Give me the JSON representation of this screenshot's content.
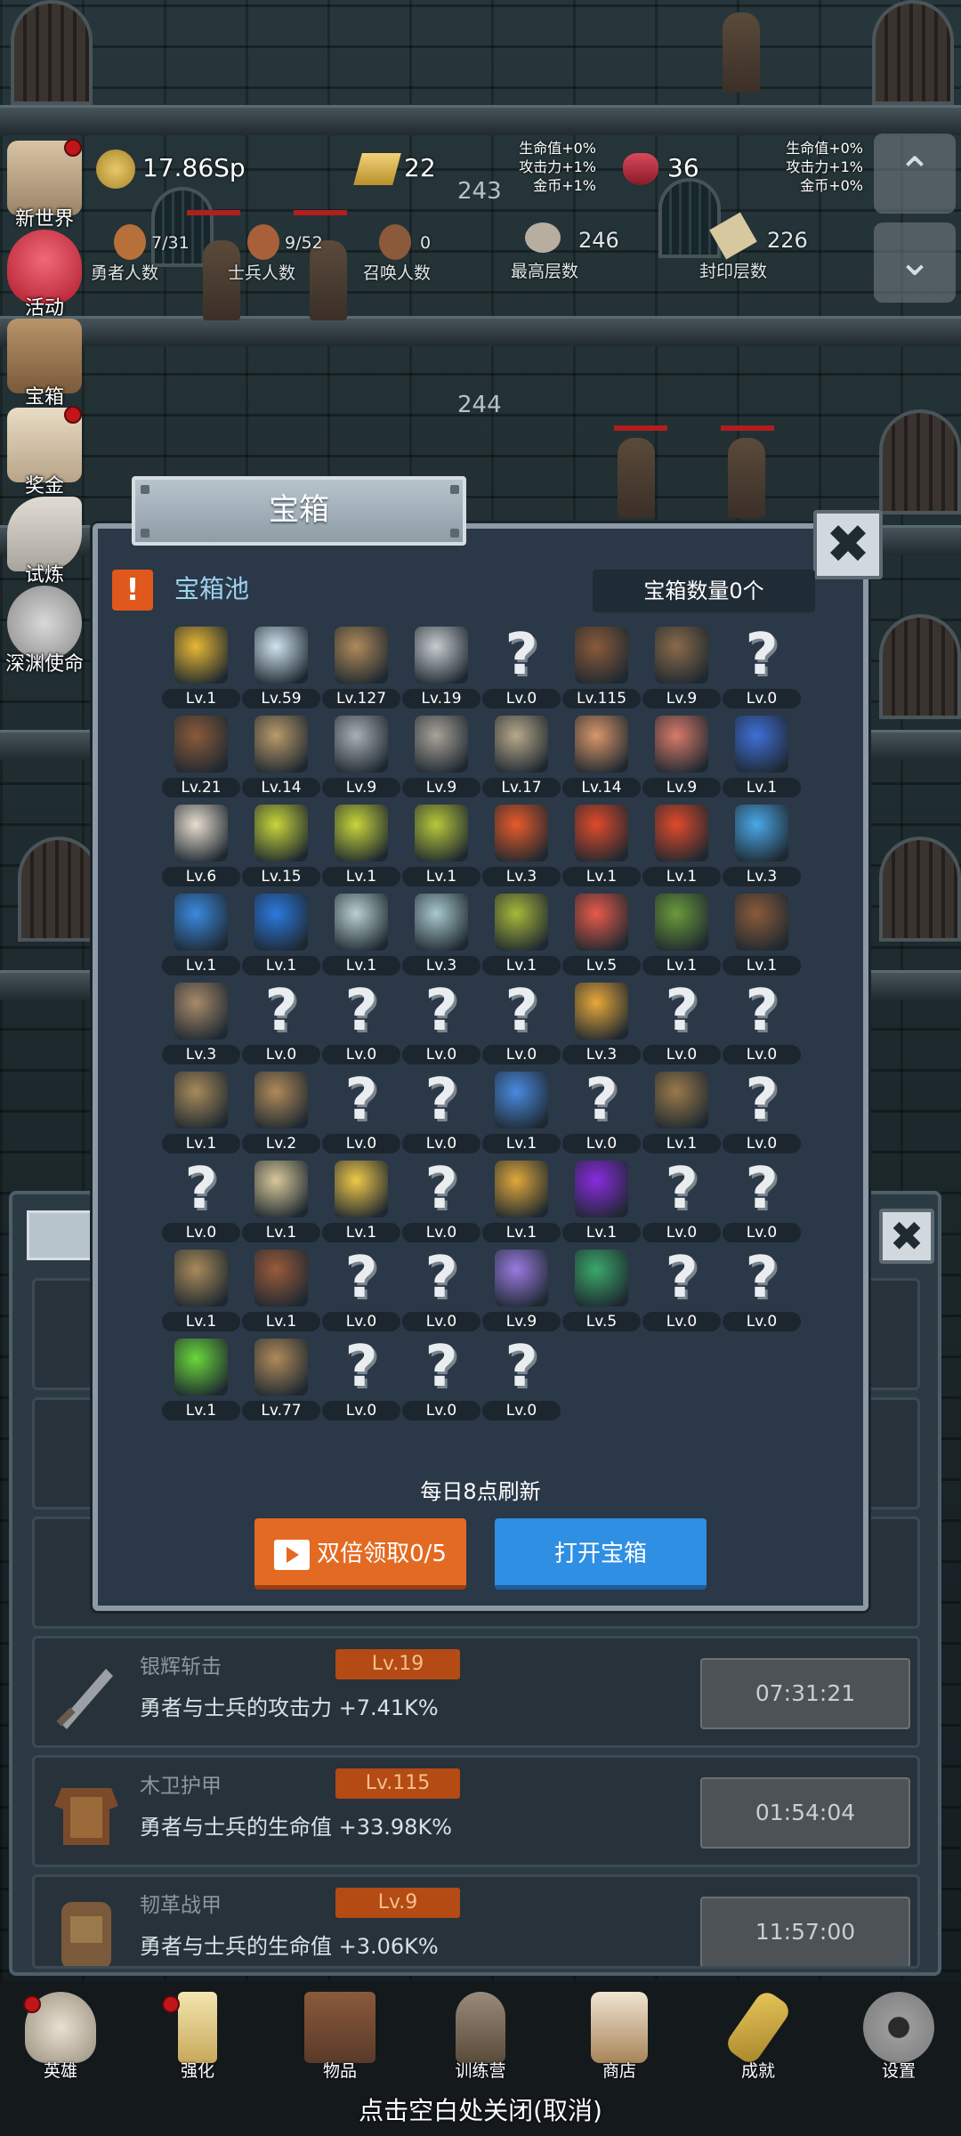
{
  "top_stats": {
    "gold": "17.86Sp",
    "ingot": "22",
    "gem": "36",
    "floor_a": "243",
    "floor_b": "244",
    "bonus_left": [
      "生命值+0%",
      "攻击力+1%",
      "金币+1%"
    ],
    "bonus_right": [
      "生命值+0%",
      "攻击力+1%",
      "金币+0%"
    ],
    "hero_count": "7/31",
    "hero_label": "勇者人数",
    "soldier_count": "9/52",
    "soldier_label": "士兵人数",
    "summon_count": "0",
    "summon_label": "召唤人数",
    "max_floor": "246",
    "max_floor_label": "最高层数",
    "seal_floor": "226",
    "seal_floor_label": "封印层数"
  },
  "side_menu": [
    "新世界",
    "活动",
    "宝箱",
    "奖金",
    "试炼",
    "深渊使命"
  ],
  "modal": {
    "title": "宝箱",
    "pool_label": "宝箱池",
    "chest_count": "宝箱数量0个",
    "refresh_text": "每日8点刷新",
    "double_btn": "双倍领取0/5",
    "open_btn": "打开宝箱",
    "close_icon": "✖"
  },
  "items": [
    {
      "icon": "crown",
      "lv": "Lv.1",
      "c": "#e8b833"
    },
    {
      "icon": "diamond",
      "lv": "Lv.59",
      "c": "#cfe3ee"
    },
    {
      "icon": "sword",
      "lv": "Lv.127",
      "c": "#b08a5a"
    },
    {
      "icon": "sword",
      "lv": "Lv.19",
      "c": "#c7ccd0"
    },
    {
      "icon": "?",
      "lv": "Lv.0"
    },
    {
      "icon": "armor",
      "lv": "Lv.115",
      "c": "#8a5a3a"
    },
    {
      "icon": "backpack",
      "lv": "Lv.9",
      "c": "#8a6a4a"
    },
    {
      "icon": "?",
      "lv": "Lv.0"
    },
    {
      "icon": "helmet",
      "lv": "Lv.21",
      "c": "#8a5a3a"
    },
    {
      "icon": "dagger",
      "lv": "Lv.14",
      "c": "#b99a6a"
    },
    {
      "icon": "helmet",
      "lv": "Lv.9",
      "c": "#a9b0b5"
    },
    {
      "icon": "hammer",
      "lv": "Lv.9",
      "c": "#a9a29a"
    },
    {
      "icon": "helmet",
      "lv": "Lv.17",
      "c": "#b8a88a"
    },
    {
      "icon": "meat",
      "lv": "Lv.14",
      "c": "#d9966a"
    },
    {
      "icon": "steak",
      "lv": "Lv.9",
      "c": "#d97a6a"
    },
    {
      "icon": "bag",
      "lv": "Lv.1",
      "c": "#3f6fd9"
    },
    {
      "icon": "flour",
      "lv": "Lv.6",
      "c": "#e8ddd0"
    },
    {
      "icon": "potion",
      "lv": "Lv.15",
      "c": "#c8d63a"
    },
    {
      "icon": "potion",
      "lv": "Lv.1",
      "c": "#c8d63a"
    },
    {
      "icon": "potion",
      "lv": "Lv.1",
      "c": "#b8c83a"
    },
    {
      "icon": "potion",
      "lv": "Lv.3",
      "c": "#e85a2a"
    },
    {
      "icon": "potion",
      "lv": "Lv.1",
      "c": "#e04a2a"
    },
    {
      "icon": "potion",
      "lv": "Lv.1",
      "c": "#e04a2a"
    },
    {
      "icon": "potion",
      "lv": "Lv.3",
      "c": "#4aa8e8"
    },
    {
      "icon": "potion",
      "lv": "Lv.1",
      "c": "#3a8ae0"
    },
    {
      "icon": "potion",
      "lv": "Lv.1",
      "c": "#2a7ae0"
    },
    {
      "icon": "bottle",
      "lv": "Lv.1",
      "c": "#b8d0d0"
    },
    {
      "icon": "bottle",
      "lv": "Lv.3",
      "c": "#a8c8cc"
    },
    {
      "icon": "bottle",
      "lv": "Lv.1",
      "c": "#a8b83a"
    },
    {
      "icon": "bottle",
      "lv": "Lv.5",
      "c": "#e85a4a"
    },
    {
      "icon": "boots",
      "lv": "Lv.1",
      "c": "#6a9a3a"
    },
    {
      "icon": "boots",
      "lv": "Lv.1",
      "c": "#8a5a3a"
    },
    {
      "icon": "boots",
      "lv": "Lv.3",
      "c": "#a88a6a"
    },
    {
      "icon": "?",
      "lv": "Lv.0"
    },
    {
      "icon": "?",
      "lv": "Lv.0"
    },
    {
      "icon": "?",
      "lv": "Lv.0"
    },
    {
      "icon": "?",
      "lv": "Lv.0"
    },
    {
      "icon": "torch",
      "lv": "Lv.3",
      "c": "#e8a83a"
    },
    {
      "icon": "?",
      "lv": "Lv.0"
    },
    {
      "icon": "?",
      "lv": "Lv.0"
    },
    {
      "icon": "pickaxe",
      "lv": "Lv.1",
      "c": "#a88a5a"
    },
    {
      "icon": "staff",
      "lv": "Lv.2",
      "c": "#b08a5a"
    },
    {
      "icon": "?",
      "lv": "Lv.0"
    },
    {
      "icon": "?",
      "lv": "Lv.0"
    },
    {
      "icon": "wand",
      "lv": "Lv.1",
      "c": "#4a8ae0"
    },
    {
      "icon": "?",
      "lv": "Lv.0"
    },
    {
      "icon": "backpack",
      "lv": "Lv.1",
      "c": "#9a7a4a"
    },
    {
      "icon": "?",
      "lv": "Lv.0"
    },
    {
      "icon": "?",
      "lv": "Lv.0"
    },
    {
      "icon": "club",
      "lv": "Lv.1",
      "c": "#d8c89a"
    },
    {
      "icon": "cheese",
      "lv": "Lv.1",
      "c": "#f0c84a"
    },
    {
      "icon": "?",
      "lv": "Lv.0"
    },
    {
      "icon": "jar",
      "lv": "Lv.1",
      "c": "#e0a83a"
    },
    {
      "icon": "crystal",
      "lv": "Lv.1",
      "c": "#8a2ae0"
    },
    {
      "icon": "?",
      "lv": "Lv.0"
    },
    {
      "icon": "?",
      "lv": "Lv.0"
    },
    {
      "icon": "bow",
      "lv": "Lv.1",
      "c": "#a88a5a"
    },
    {
      "icon": "quiver",
      "lv": "Lv.1",
      "c": "#9a5a3a"
    },
    {
      "icon": "?",
      "lv": "Lv.0"
    },
    {
      "icon": "?",
      "lv": "Lv.0"
    },
    {
      "icon": "monster",
      "lv": "Lv.9",
      "c": "#9a7ae0"
    },
    {
      "icon": "emblem",
      "lv": "Lv.5",
      "c": "#3aa86a"
    },
    {
      "icon": "?",
      "lv": "Lv.0"
    },
    {
      "icon": "?",
      "lv": "Lv.0"
    },
    {
      "icon": "wand",
      "lv": "Lv.1",
      "c": "#6ad83a"
    },
    {
      "icon": "mug",
      "lv": "Lv.77",
      "c": "#b08a5a"
    },
    {
      "icon": "?",
      "lv": "Lv.0"
    },
    {
      "icon": "?",
      "lv": "Lv.0"
    },
    {
      "icon": "?",
      "lv": "Lv.0"
    }
  ],
  "equip_list": [
    {
      "name": "银辉斩击",
      "lv": "Lv.19",
      "desc": "勇者与士兵的攻击力 +7.41K%",
      "timer": "07:31:21",
      "icon": "sword"
    },
    {
      "name": "木卫护甲",
      "lv": "Lv.115",
      "desc": "勇者与士兵的生命值 +33.98K%",
      "timer": "01:54:04",
      "icon": "armor"
    },
    {
      "name": "韧革战甲",
      "lv": "Lv.9",
      "desc": "勇者与士兵的生命值 +3.06K%",
      "timer": "11:57:00",
      "icon": "backpack"
    }
  ],
  "bottom_nav": [
    "英雄",
    "强化",
    "物品",
    "训练营",
    "商店",
    "成就",
    "设置"
  ],
  "footer_text": "点击空白处关闭(取消)"
}
